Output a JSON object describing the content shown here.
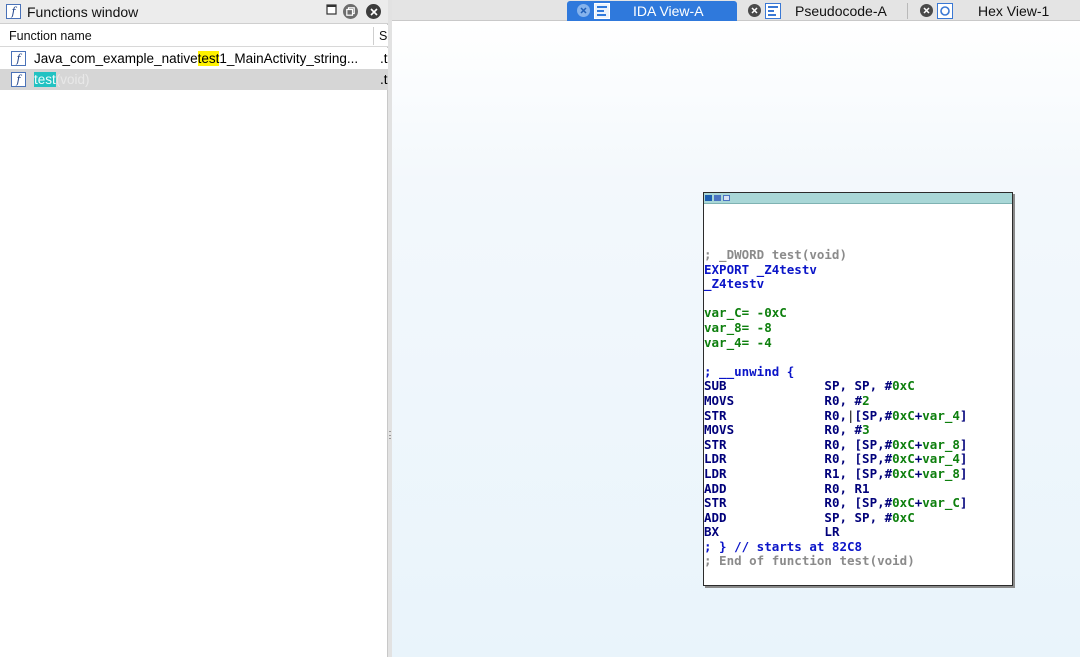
{
  "functions_window": {
    "title": "Functions window",
    "columns": {
      "name": "Function name",
      "segment": "Se"
    },
    "rows": [
      {
        "name_pre": "Java_com_example_native",
        "name_match": "test",
        "name_post": "1_MainActivity_string...",
        "segment": ".t"
      },
      {
        "name_pre": "",
        "name_match": "test",
        "name_post": "(void)",
        "segment": ".t"
      }
    ]
  },
  "tabs": [
    {
      "label": "IDA View-A",
      "active": true
    },
    {
      "label": "Pseudocode-A",
      "active": false
    },
    {
      "label": "Hex View-1",
      "active": false
    }
  ],
  "graph_node": {
    "lines": [
      [
        {
          "t": "; _DWORD test(void)",
          "c": "cmt"
        }
      ],
      [
        {
          "t": "EXPORT _Z4testv",
          "c": "blue"
        }
      ],
      [
        {
          "t": "_Z4testv",
          "c": "blue"
        }
      ],
      [
        {
          "t": "",
          "c": "blue"
        }
      ],
      [
        {
          "t": "var_C= -0xC",
          "c": "green"
        }
      ],
      [
        {
          "t": "var_8= -8",
          "c": "green"
        }
      ],
      [
        {
          "t": "var_4= -4",
          "c": "green"
        }
      ],
      [
        {
          "t": "",
          "c": "blue"
        }
      ],
      [
        {
          "t": "; __unwind {",
          "c": "blue"
        }
      ],
      [
        {
          "t": "SUB             ",
          "c": "navy"
        },
        {
          "t": "SP, SP, #",
          "c": "navy"
        },
        {
          "t": "0xC",
          "c": "green"
        }
      ],
      [
        {
          "t": "MOVS            ",
          "c": "navy"
        },
        {
          "t": "R0, #",
          "c": "navy"
        },
        {
          "t": "2",
          "c": "green"
        }
      ],
      [
        {
          "t": "STR             ",
          "c": "navy"
        },
        {
          "t": "R0,",
          "c": "navy"
        },
        {
          "t": "|",
          "c": "caret"
        },
        {
          "t": "[SP,#",
          "c": "navy"
        },
        {
          "t": "0xC",
          "c": "green"
        },
        {
          "t": "+",
          "c": "navy"
        },
        {
          "t": "var_4",
          "c": "green"
        },
        {
          "t": "]",
          "c": "navy"
        }
      ],
      [
        {
          "t": "MOVS            ",
          "c": "navy"
        },
        {
          "t": "R0, #",
          "c": "navy"
        },
        {
          "t": "3",
          "c": "green"
        }
      ],
      [
        {
          "t": "STR             ",
          "c": "navy"
        },
        {
          "t": "R0, [SP,#",
          "c": "navy"
        },
        {
          "t": "0xC",
          "c": "green"
        },
        {
          "t": "+",
          "c": "navy"
        },
        {
          "t": "var_8",
          "c": "green"
        },
        {
          "t": "]",
          "c": "navy"
        }
      ],
      [
        {
          "t": "LDR             ",
          "c": "navy"
        },
        {
          "t": "R0, [SP,#",
          "c": "navy"
        },
        {
          "t": "0xC",
          "c": "green"
        },
        {
          "t": "+",
          "c": "navy"
        },
        {
          "t": "var_4",
          "c": "green"
        },
        {
          "t": "]",
          "c": "navy"
        }
      ],
      [
        {
          "t": "LDR             ",
          "c": "navy"
        },
        {
          "t": "R1, [SP,#",
          "c": "navy"
        },
        {
          "t": "0xC",
          "c": "green"
        },
        {
          "t": "+",
          "c": "navy"
        },
        {
          "t": "var_8",
          "c": "green"
        },
        {
          "t": "]",
          "c": "navy"
        }
      ],
      [
        {
          "t": "ADD             ",
          "c": "navy"
        },
        {
          "t": "R0, R1",
          "c": "navy"
        }
      ],
      [
        {
          "t": "STR             ",
          "c": "navy"
        },
        {
          "t": "R0, [SP,#",
          "c": "navy"
        },
        {
          "t": "0xC",
          "c": "green"
        },
        {
          "t": "+",
          "c": "navy"
        },
        {
          "t": "var_C",
          "c": "green"
        },
        {
          "t": "]",
          "c": "navy"
        }
      ],
      [
        {
          "t": "ADD             ",
          "c": "navy"
        },
        {
          "t": "SP, SP, #",
          "c": "navy"
        },
        {
          "t": "0xC",
          "c": "green"
        }
      ],
      [
        {
          "t": "BX              ",
          "c": "navy"
        },
        {
          "t": "LR",
          "c": "navy"
        }
      ],
      [
        {
          "t": "; } // starts at 82C8",
          "c": "blue"
        }
      ],
      [
        {
          "t": "; End of function test(void)",
          "c": "cmt"
        }
      ]
    ]
  },
  "colors": {
    "active_tab": "#2f79dc",
    "search_match_1": "#fff200",
    "search_match_2": "#22c2c2",
    "selected_row": "#d6d6d6",
    "node_titlebar": "#a9d7d7"
  },
  "icons": {
    "function": "function-f-icon",
    "restore": "restore-window-icon",
    "float": "float-window-icon",
    "close": "close-icon",
    "ida_view": "disassembly-view-icon",
    "pseudocode": "pseudocode-icon",
    "hex_view": "hex-view-icon"
  }
}
